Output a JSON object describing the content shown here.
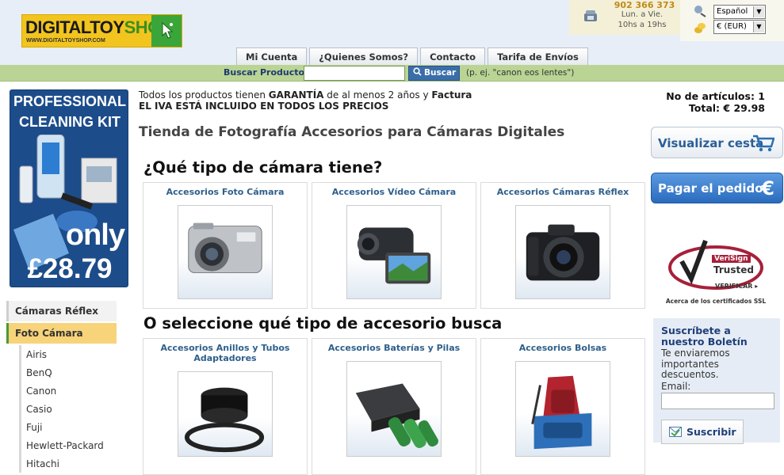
{
  "header": {
    "logo": {
      "text_a": "DIGITALTOY",
      "text_b": "SHOP",
      "url": "WWW.DIGITALTOYSHOP.COM"
    },
    "phone": {
      "number": "902 366 373",
      "days": "Lun. a Vie.",
      "hours": "10hs a 19hs"
    },
    "language": {
      "selected": "Español"
    },
    "currency": {
      "selected": "€ (EUR)"
    }
  },
  "tabs": [
    "Mi Cuenta",
    "¿Quienes Somos?",
    "Contacto",
    "Tarifa de Envíos"
  ],
  "search": {
    "label": "Buscar Productos",
    "value": "",
    "button": "Buscar",
    "hint": "(p. ej. \"canon eos lentes\")"
  },
  "promo": {
    "line1": "PROFESSIONAL",
    "line2": "CLEANING KIT",
    "only": "only",
    "price": "£28.79"
  },
  "categories": {
    "head1": "Cámaras Réflex",
    "head2": "Foto Cámara",
    "brands": [
      "Airis",
      "BenQ",
      "Canon",
      "Casio",
      "Fuji",
      "Hewlett-Packard",
      "Hitachi"
    ]
  },
  "notice": {
    "l1a": "Todos los productos tienen ",
    "l1b": "GARANTÍA",
    "l1c": " de al menos 2 años y ",
    "l1d": "Factura",
    "l2": "EL IVA ESTÁ INCLUIDO EN TODOS LOS PRECIOS"
  },
  "page_title": "Tienda de Fotografía Accesorios para Cámaras Digitales",
  "camera_section": {
    "title": "¿Qué tipo de cámara tiene?",
    "items": [
      "Accesorios Foto Cámara",
      "Accesorios Vídeo Cámara",
      "Accesorios Cámaras Réflex"
    ]
  },
  "accessory_section": {
    "title": "O seleccione qué tipo de accesorio busca",
    "items": [
      "Accesorios Anillos y Tubos Adaptadores",
      "Accesorios Baterías y Pilas",
      "Accesorios Bolsas"
    ]
  },
  "cart": {
    "count_label": "No de artículos: 1",
    "total_label": "Total: € 29.98",
    "view_button": "Visualizar cesta",
    "pay_button": "Pagar el pedido",
    "pay_symbol": "€"
  },
  "verisign": {
    "brand": "VeriSign",
    "trusted": "Trusted",
    "verify": "VERIFICAR ▸",
    "about": "Acerca de los certificados SSL"
  },
  "newsletter": {
    "title": "Suscríbete a nuestro Boletín",
    "text": "Te enviaremos importantes descuentos.",
    "email_label": "Email:",
    "email_value": "",
    "button": "Suscribir"
  },
  "colors": {
    "accent_blue": "#2b5e96",
    "search_green": "#b9d494",
    "category_active": "#f7d37a"
  }
}
